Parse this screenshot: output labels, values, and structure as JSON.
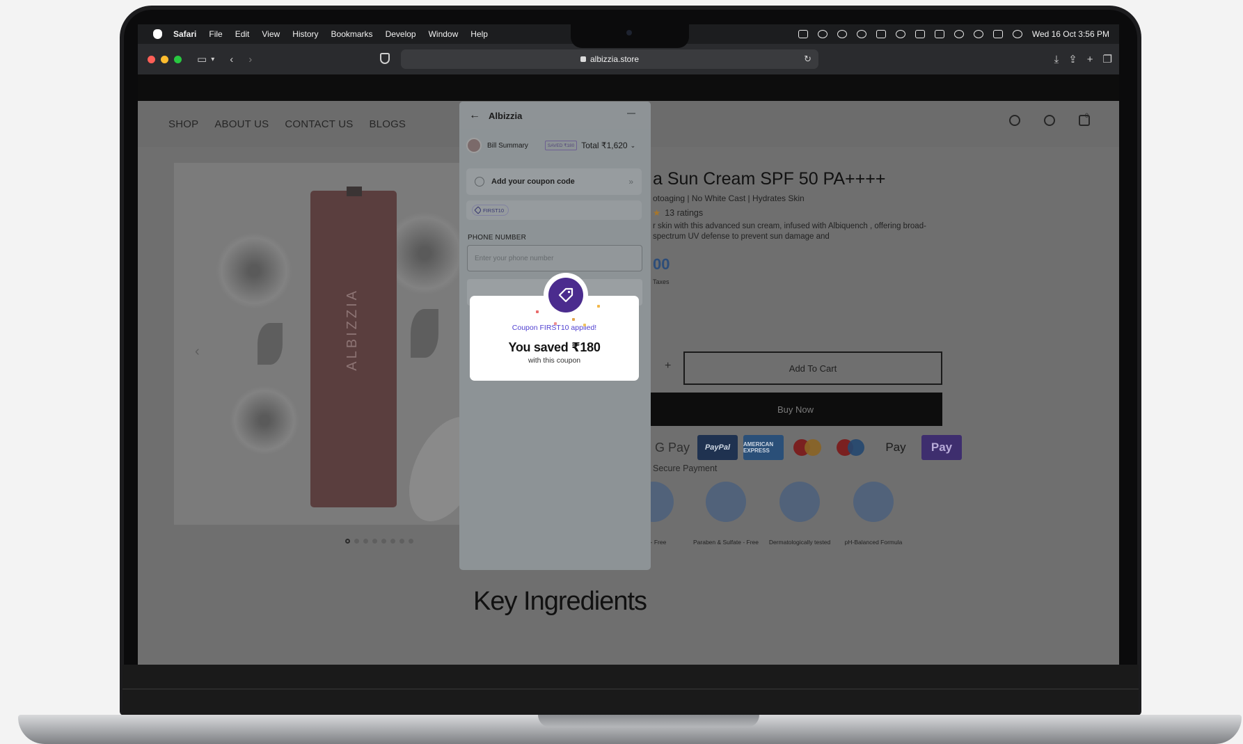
{
  "os_menubar": {
    "app_name": "Safari",
    "menus": [
      "File",
      "Edit",
      "View",
      "History",
      "Bookmarks",
      "Develop",
      "Window",
      "Help"
    ],
    "clock": "Wed 16 Oct  3:56 PM"
  },
  "browser": {
    "url": "albizzia.store"
  },
  "site": {
    "nav": [
      "SHOP",
      "ABOUT US",
      "CONTACT US",
      "BLOGS"
    ],
    "cart_count": "0",
    "product": {
      "title": "a Sun Cream SPF 50 PA++++",
      "subtitle": "otoaging | No White Cast | Hydrates Skin",
      "ratings": "13 ratings",
      "description": "r skin with this advanced sun cream, infused with Albiquench , offering broad-spectrum UV defense to prevent sun damage and",
      "price_fragment": "00",
      "taxes_fragment": "Taxes",
      "qty_plus": "+",
      "add_to_cart": "Add To Cart",
      "buy_now": "Buy Now",
      "tube_brand": "ALBIZZIA"
    },
    "payments": [
      "G Pay",
      "PayPal",
      "AMERICAN EXPRESS",
      "mastercard",
      "maestro",
      " Pay",
      "Pay"
    ],
    "secure_payment": "Secure Payment",
    "badges": [
      "- Free",
      "Paraben & Sulfate - Free",
      "Dermatologically tested",
      "pH-Balanced Formula"
    ],
    "section_heading": "Key Ingredients"
  },
  "checkout": {
    "brand": "Albizzia",
    "bill_label": "Bill Summary",
    "saved_chip": "SAVED ₹180",
    "total": "Total ₹1,620",
    "coupon_prompt": "Add your coupon code",
    "coupon_chip": "FIRST10",
    "phone_label": "PHONE NUMBER",
    "phone_placeholder": "Enter your phone number"
  },
  "success_modal": {
    "title": "Coupon FIRST10 applied!",
    "amount": "You saved ₹180",
    "subtitle": "with this coupon"
  },
  "colors": {
    "accent_purple": "#4b2c8e",
    "modal_title": "#4f3fd0"
  }
}
